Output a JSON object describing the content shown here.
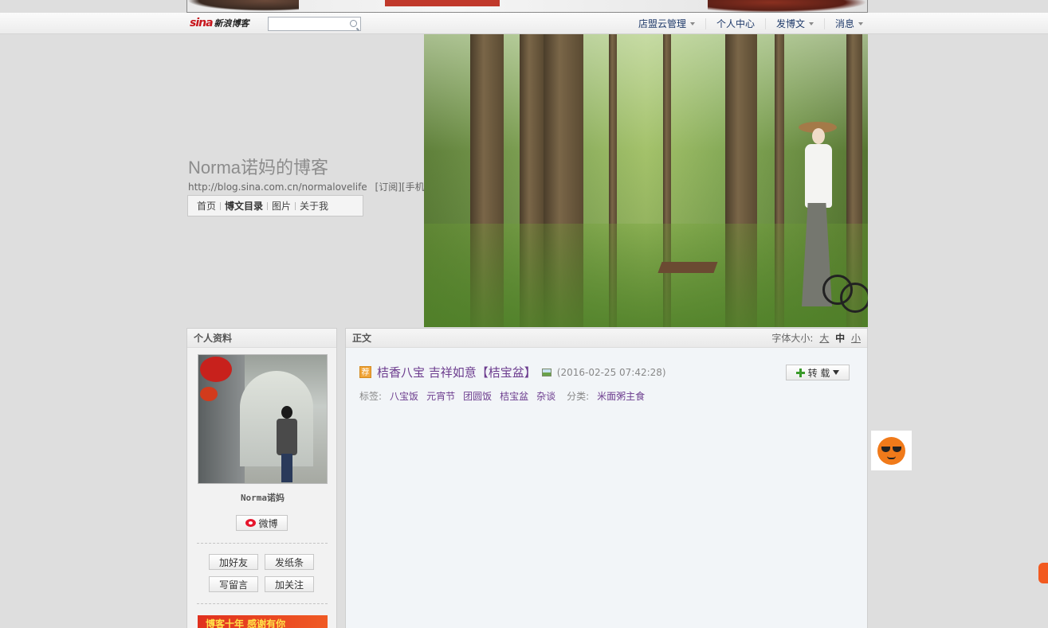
{
  "navbar": {
    "logo_main": "sina",
    "logo_sub": "新浪博客",
    "search_placeholder": "",
    "links": [
      "店盟云管理",
      "个人中心",
      "发博文",
      "消息"
    ]
  },
  "header": {
    "title": "Norma诺妈的博客",
    "url": "http://blog.sina.com.cn/normalovelife",
    "subscribe": "[订阅]",
    "mobile_subscribe": "[手机订阅]",
    "tabs": [
      "首页",
      "博文目录",
      "图片",
      "关于我"
    ]
  },
  "sidebar": {
    "title": "个人资料",
    "nickname": "Norma诺妈",
    "weibo_label": "微博",
    "actions": [
      "加好友",
      "发纸条",
      "写留言",
      "加关注"
    ],
    "ad_text": "博客十年 感谢有你"
  },
  "main": {
    "title": "正文",
    "fontsize_label": "字体大小:",
    "fontsizes": [
      "大",
      "中",
      "小"
    ],
    "rec_badge": "荐",
    "article_title": "桔香八宝 吉祥如意【桔宝盆】",
    "article_time": "(2016-02-25 07:42:28)",
    "repost_label": "转 载",
    "tags_label": "标签:",
    "tags": [
      "八宝饭",
      "元宵节",
      "团圆饭",
      "桔宝盆",
      "杂谈"
    ],
    "category_label": "分类:",
    "category": "米面粥主食"
  },
  "colors": {
    "title_purple": "#6c3c8e",
    "nav_blue": "#1f3a6a",
    "sina_red": "#c8161d",
    "widget_orange": "#f07a1a"
  }
}
